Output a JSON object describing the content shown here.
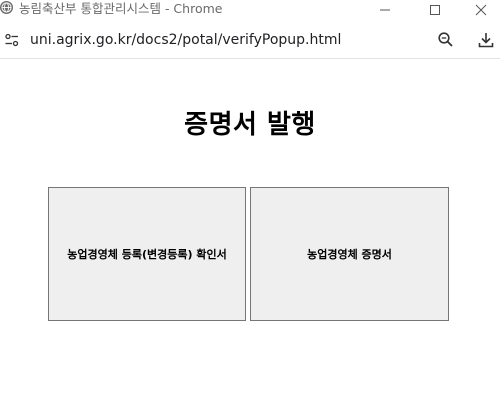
{
  "window": {
    "title": "농림축산부 통합관리시스템 - Chrome"
  },
  "addressbar": {
    "url": "uni.agrix.go.kr/docs2/potal/verifyPopup.html"
  },
  "icons": {
    "favicon": "globe-icon",
    "minimize": "minimize-icon",
    "maximize": "maximize-icon",
    "close": "close-icon",
    "site_info": "tune-icon",
    "zoom": "zoom-icon",
    "download": "download-icon"
  },
  "page": {
    "title": "증명서 발행",
    "buttons": [
      {
        "label": "농업경영체 등록(변경등록) 확인서"
      },
      {
        "label": "농업경영체 증명서"
      }
    ]
  },
  "colors": {
    "button_bg": "#efefef",
    "button_border": "#767676",
    "title_text": "#6a6a6a"
  }
}
